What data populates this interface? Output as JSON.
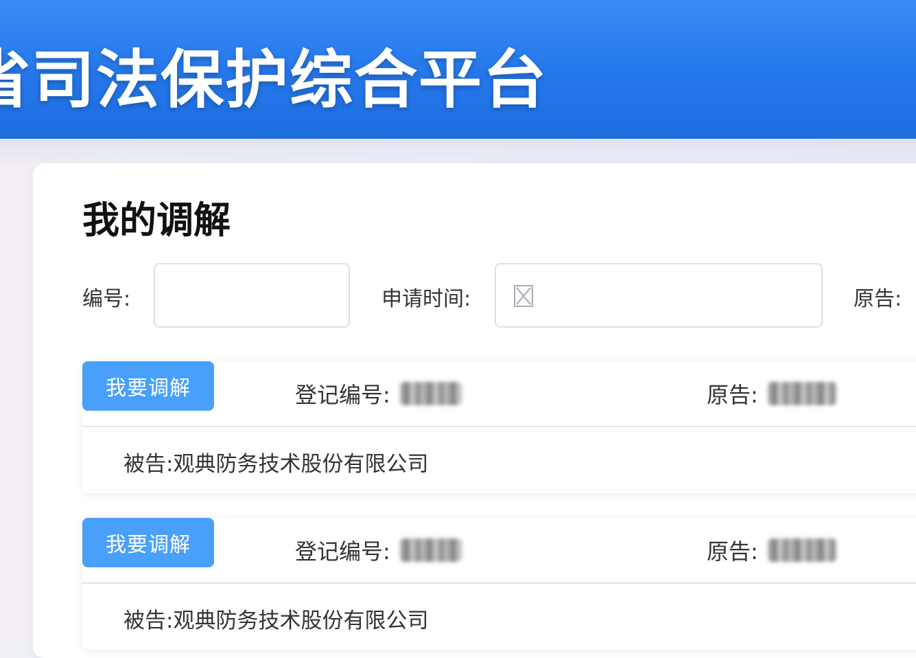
{
  "header": {
    "title": "省司法保护综合平台"
  },
  "page": {
    "title": "我的调解"
  },
  "filters": {
    "number_label": "编号:",
    "number_value": "",
    "apply_time_label": "申请时间:",
    "apply_time_value": "",
    "plaintiff_label": "原告:"
  },
  "records": [
    {
      "action_label": "我要调解",
      "reg_no_label": "登记编号:",
      "plaintiff_label": "原告:",
      "defendant_label": "被告:",
      "defendant_value": "观典防务技术股份有限公司"
    },
    {
      "action_label": "我要调解",
      "reg_no_label": "登记编号:",
      "plaintiff_label": "原告:",
      "defendant_label": "被告:",
      "defendant_value": "观典防务技术股份有限公司"
    }
  ],
  "colors": {
    "header_blue": "#2477ea",
    "button_blue": "#49a0fb"
  }
}
